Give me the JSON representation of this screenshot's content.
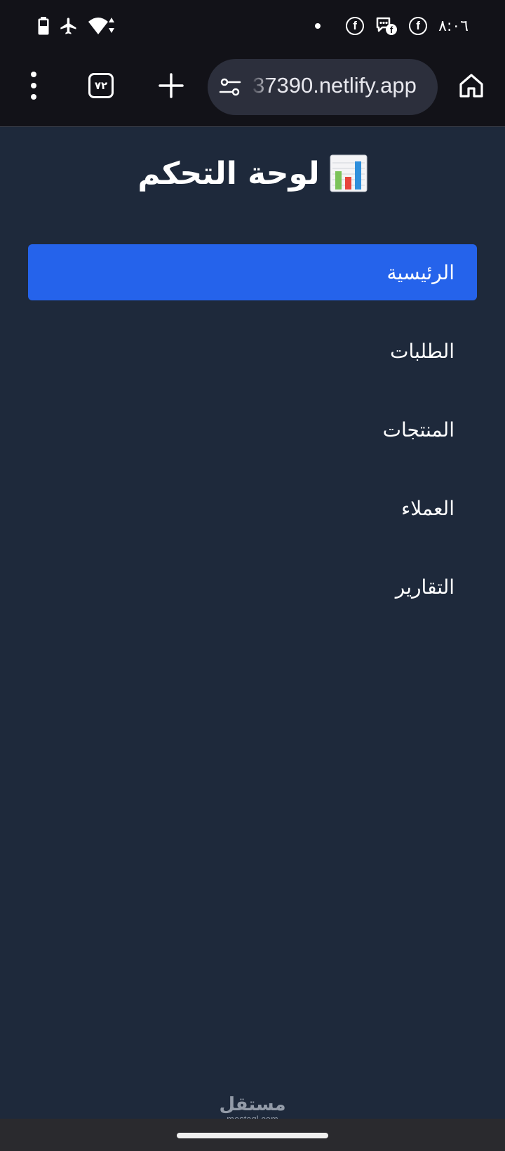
{
  "status_bar": {
    "time": "٨:٠٦",
    "icons": [
      "battery-icon",
      "airplane-mode-icon",
      "wifi-icon",
      "notification-dot-icon",
      "facebook-icon",
      "messenger-icon",
      "facebook-icon"
    ],
    "facebook_glyph": "f"
  },
  "browser": {
    "url": "37390.netlify.app",
    "tab_count": "٧٢",
    "icons": [
      "more-options-icon",
      "tab-switcher-icon",
      "new-tab-icon",
      "site-settings-icon",
      "home-icon"
    ]
  },
  "page": {
    "title_text": "لوحة التحكم",
    "title_icon": "bar-chart-icon",
    "nav": [
      {
        "label": "الرئيسية",
        "active": true
      },
      {
        "label": "الطلبات",
        "active": false
      },
      {
        "label": "المنتجات",
        "active": false
      },
      {
        "label": "العملاء",
        "active": false
      },
      {
        "label": "التقارير",
        "active": false
      }
    ]
  },
  "watermark": {
    "arabic": "مستقل",
    "latin": "mostaql.com"
  },
  "colors": {
    "background": "#1e293b",
    "active_item": "#2563eb",
    "system_bar": "#121218",
    "url_bar": "#2c2f3c"
  }
}
